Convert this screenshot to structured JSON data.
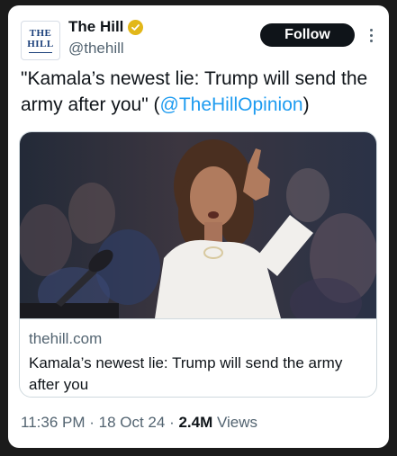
{
  "account": {
    "avatar_line1": "THE",
    "avatar_line2": "HILL",
    "name": "The Hill",
    "handle": "@thehill",
    "verified_icon": "verified-badge-icon",
    "verified_color": "#e2b719"
  },
  "actions": {
    "follow_label": "Follow",
    "more_icon": "more-vertical-icon"
  },
  "tweet": {
    "text": "\"Kamala’s newest lie: Trump will send the army after you\" (",
    "mention": "@TheHillOpinion",
    "text_end": ")"
  },
  "link_card": {
    "image": "photo-speaker-at-podium",
    "domain": "thehill.com",
    "title": "Kamala’s newest lie: Trump will send the army after you"
  },
  "meta": {
    "time": "11:36 PM",
    "sep1": " · ",
    "date": "18 Oct 24",
    "sep2": " · ",
    "views_count": "2.4M",
    "views_label": " Views"
  },
  "colors": {
    "accent": "#1d9bf0",
    "text": "#0f1419",
    "secondary": "#536471"
  }
}
